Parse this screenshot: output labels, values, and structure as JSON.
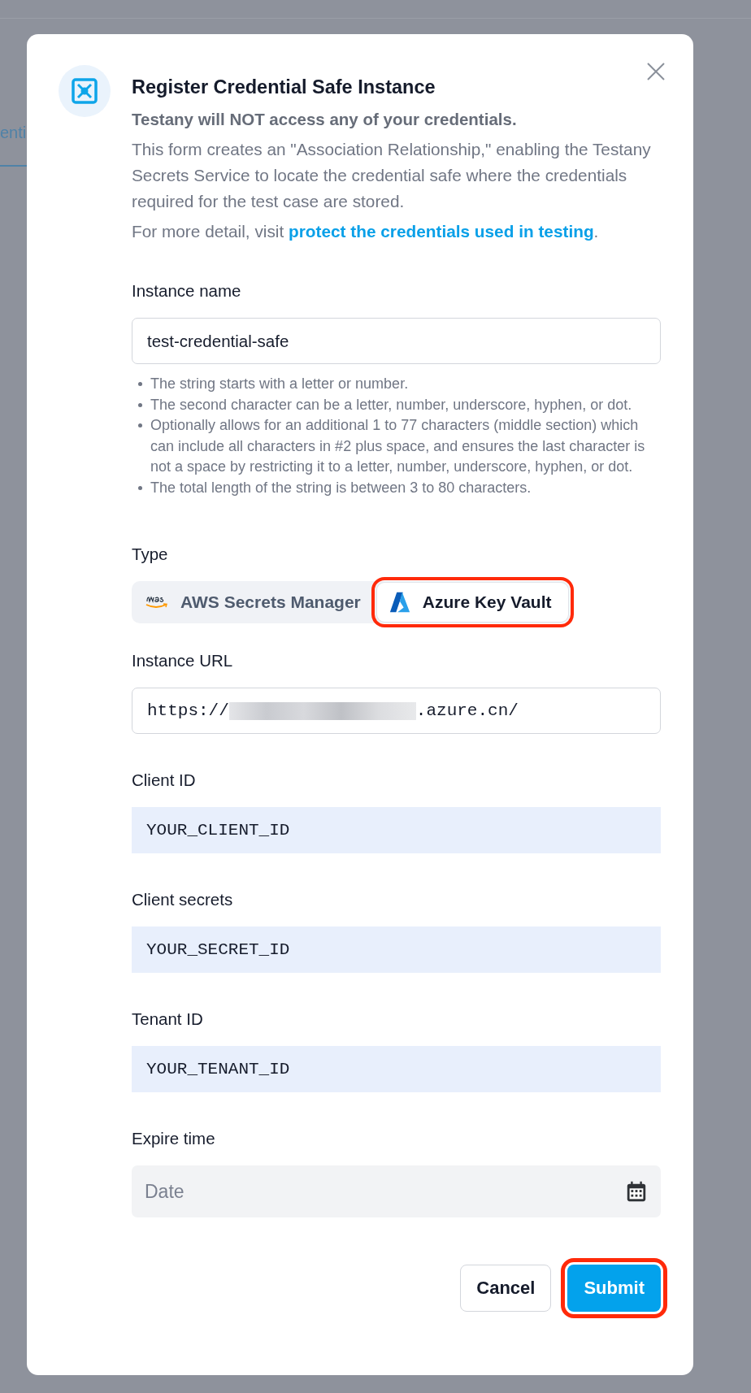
{
  "background": {
    "tab_label": "enti"
  },
  "dialog": {
    "title": "Register Credential Safe Instance",
    "warning": "Testany will NOT access any of your credentials.",
    "description": "This form creates an \"Association Relationship,\" enabling the Testany Secrets Service to locate the credential safe where the credentials required for the test case are stored.",
    "more_detail": "For more detail, visit ",
    "link": "protect the credentials used in testing",
    "link_suffix": "."
  },
  "fields": [
    {
      "kind": "text",
      "label": "Instance name",
      "value": "test-credential-safe",
      "rules": [
        "The string starts with a letter or number.",
        "The second character can be a letter, number, underscore, hyphen, or dot.",
        "Optionally allows for an additional 1 to 77 characters (middle section) which can include all characters in #2 plus space, and ensures the last character is not a space by restricting it to a letter, number, underscore, hyphen, or dot.",
        "The total length of the string is between 3 to 80 characters."
      ]
    },
    {
      "kind": "segmented",
      "label": "Type",
      "options": [
        {
          "label": "AWS Secrets Manager",
          "kind": "aws",
          "selected": false,
          "highlighted": false
        },
        {
          "label": "Azure Key Vault",
          "kind": "azure",
          "selected": true,
          "highlighted": true
        }
      ]
    },
    {
      "kind": "url",
      "label": "Instance URL",
      "value_start": "https://",
      "value_end": ".azure.cn/"
    },
    {
      "kind": "filled",
      "label": "Client ID",
      "value": "YOUR_CLIENT_ID"
    },
    {
      "kind": "filled",
      "label": "Client secrets",
      "value": "YOUR_SECRET_ID"
    },
    {
      "kind": "filled",
      "label": "Tenant ID",
      "value": "YOUR_TENANT_ID"
    },
    {
      "kind": "date",
      "label": "Expire time",
      "placeholder": "Date"
    }
  ],
  "buttons": [
    {
      "label": "Cancel",
      "kind": "secondary",
      "highlighted": false
    },
    {
      "label": "Submit",
      "kind": "primary",
      "highlighted": true
    }
  ]
}
